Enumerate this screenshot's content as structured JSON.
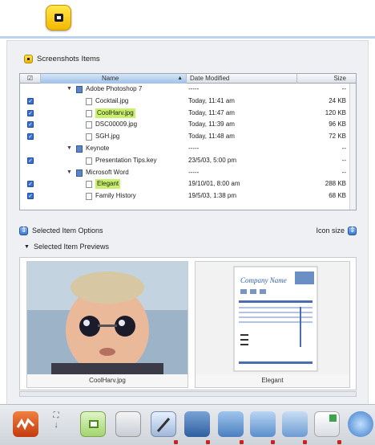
{
  "section": {
    "title": "Screenshots Items"
  },
  "table": {
    "columns": {
      "check": "☑",
      "name": "Name",
      "date": "Date Modified",
      "size": "Size"
    },
    "rows": [
      {
        "type": "group",
        "name": "Adobe Photoshop 7",
        "date": "-----",
        "size": "--",
        "checked": false
      },
      {
        "type": "item",
        "name": "Cocktail.jpg",
        "date": "Today, 11:41 am",
        "size": "24 KB",
        "checked": true,
        "highlight": false
      },
      {
        "type": "item",
        "name": "CoolHarv.jpg",
        "date": "Today, 11:47 am",
        "size": "120 KB",
        "checked": true,
        "highlight": true
      },
      {
        "type": "item",
        "name": "DSC00009.jpg",
        "date": "Today, 11:39 am",
        "size": "96 KB",
        "checked": true,
        "highlight": false
      },
      {
        "type": "item",
        "name": "SGH.jpg",
        "date": "Today, 11:48 am",
        "size": "72 KB",
        "checked": true,
        "highlight": false
      },
      {
        "type": "group",
        "name": "Keynote",
        "date": "-----",
        "size": "--",
        "checked": false
      },
      {
        "type": "item",
        "name": "Presentation Tips.key",
        "date": "23/5/03, 5:00 pm",
        "size": "--",
        "checked": true,
        "highlight": false
      },
      {
        "type": "group",
        "name": "Microsoft Word",
        "date": "-----",
        "size": "--",
        "checked": false
      },
      {
        "type": "item",
        "name": "Elegant",
        "date": "19/10/01, 8:00 am",
        "size": "288 KB",
        "checked": true,
        "highlight": true
      },
      {
        "type": "item",
        "name": "Family History",
        "date": "19/5/03, 1:38 pm",
        "size": "68 KB",
        "checked": true,
        "highlight": false
      }
    ]
  },
  "options": {
    "selected_item_options": "Selected Item Options",
    "icon_size": "Icon size"
  },
  "previews": {
    "header": "Selected Item Previews",
    "items": [
      {
        "caption": "CoolHarv.jpg"
      },
      {
        "caption": "Elegant"
      }
    ],
    "doc_title": "Company Name"
  },
  "colors": {
    "highlight": "#c9f06b",
    "accent": "#3a78d4",
    "dock_dot": "#d21f1f"
  }
}
